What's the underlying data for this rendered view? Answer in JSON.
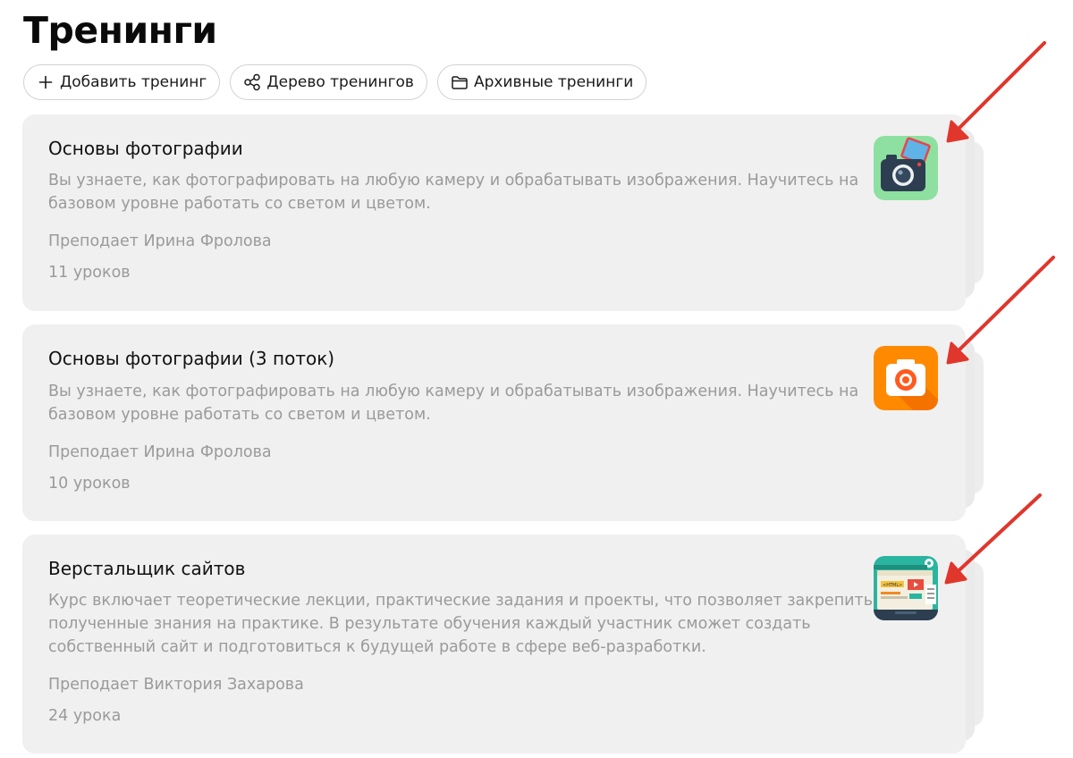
{
  "page": {
    "title": "Тренинги"
  },
  "toolbar": {
    "add_label": "Добавить тренинг",
    "tree_label": "Дерево тренингов",
    "archive_label": "Архивные тренинги"
  },
  "trainings": [
    {
      "title": "Основы фотографии",
      "description": "Вы узнаете, как фотографировать на любую камеру и обрабатывать изображения. Научитесь на базовом уровне работать со светом и цветом.",
      "teacher": "Преподает Ирина Фролова",
      "lessons": "11 уроков",
      "icon": "camera-green-icon"
    },
    {
      "title": "Основы фотографии (3 поток)",
      "description": "Вы узнаете, как фотографировать на любую камеру и обрабатывать изображения. Научитесь на базовом уровне работать со светом и цветом.",
      "teacher": "Преподает Ирина Фролова",
      "lessons": "10 уроков",
      "icon": "camera-orange-icon"
    },
    {
      "title": "Верстальщик сайтов",
      "description": "Курс включает теоретические лекции, практические задания и проекты, что позволяет закрепить полученные знания на практике. В результате обучения каждый участник сможет создать собственный сайт и подготовиться к будущей работе в сфере веб-разработки.",
      "teacher": "Преподает Виктория Захарова",
      "lessons": "24 урока",
      "icon": "web-layout-icon"
    }
  ],
  "colors": {
    "card_bg": "#f0f0f0",
    "muted_text": "#9a9a9a",
    "arrow": "#e0362c"
  }
}
